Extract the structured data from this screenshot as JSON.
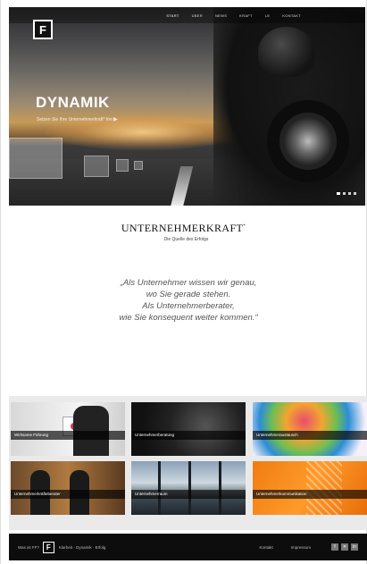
{
  "nav": {
    "items": [
      {
        "label": "START",
        "active": true
      },
      {
        "label": "ÜBER",
        "active": false
      },
      {
        "label": "NEWS",
        "active": false
      },
      {
        "label": "KRAFT",
        "active": false
      },
      {
        "label": "LE",
        "active": false
      },
      {
        "label": "KONTAKT",
        "active": false
      }
    ]
  },
  "logo": {
    "letter": "F",
    "icon": "brand-f-logo"
  },
  "hero": {
    "title": "DYNAMIK",
    "subtitle": "Setzen Sie Ihre Unternehmerkraft* frei",
    "arrow": "▶"
  },
  "brand": {
    "title": "UNTERNEHMERKRAFT",
    "mark": "*",
    "subtitle": "Die Quelle des Erfolgs"
  },
  "quote": {
    "line1": "„Als Unternehmer wissen wir genau,",
    "line2": "wo Sie gerade stehen.",
    "line3": "Als Unternehmerberater,",
    "line4": "wie Sie konsequent weiter kommen.“"
  },
  "tiles": [
    {
      "caption": "Wirksame Führung"
    },
    {
      "caption": "Unternehmerberatung"
    },
    {
      "caption": "Unternehmeraustausch"
    },
    {
      "caption": "Unternehmerkräfteberater"
    },
    {
      "caption": "Unternehmerraum"
    },
    {
      "caption": "Unternehmerkommunikation"
    }
  ],
  "footer": {
    "label": "Was ist FF?",
    "logo_letter": "F",
    "tagline": "Klarheit · Dynamik · Erfolg",
    "link1": "Kontakt",
    "link2": "Impressum",
    "social": [
      "f",
      "✕",
      "in"
    ]
  },
  "colors": {
    "accent": "#f07c12",
    "footer_bg": "#0d0d0d"
  }
}
